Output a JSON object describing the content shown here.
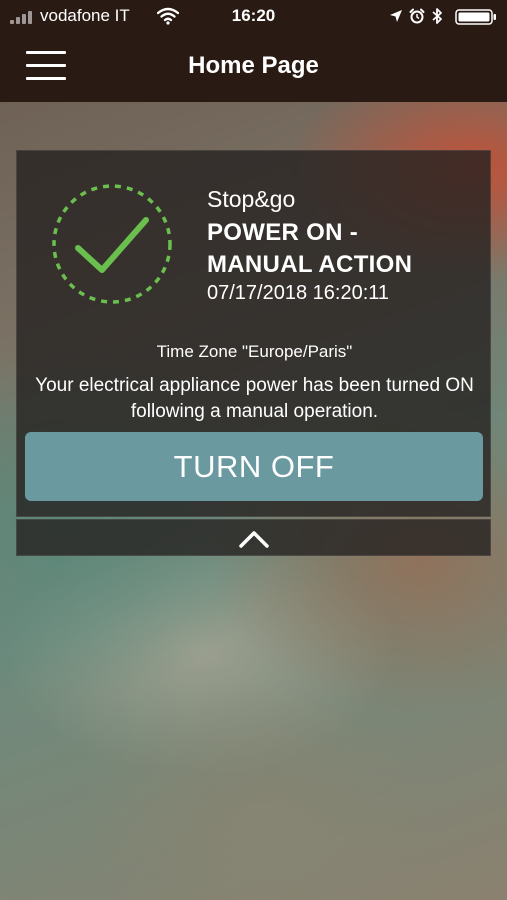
{
  "status_bar": {
    "carrier": "vodafone IT",
    "time": "16:20"
  },
  "header": {
    "title": "Home Page",
    "menu_icon": "hamburger-menu-icon"
  },
  "card": {
    "status_icon": "checkmark-icon",
    "status_color": "#6bbf4e",
    "source": "Stop&go",
    "title_line1": "POWER ON -",
    "title_line2": "MANUAL ACTION",
    "timestamp": "07/17/2018 16:20:11",
    "timezone": "Time Zone \"Europe/Paris\"",
    "description": "Your electrical appliance power has been turned ON following a manual operation.",
    "button_label": "TURN OFF",
    "button_color": "#6a9aa0"
  },
  "collapse": {
    "icon": "chevron-up-icon"
  }
}
